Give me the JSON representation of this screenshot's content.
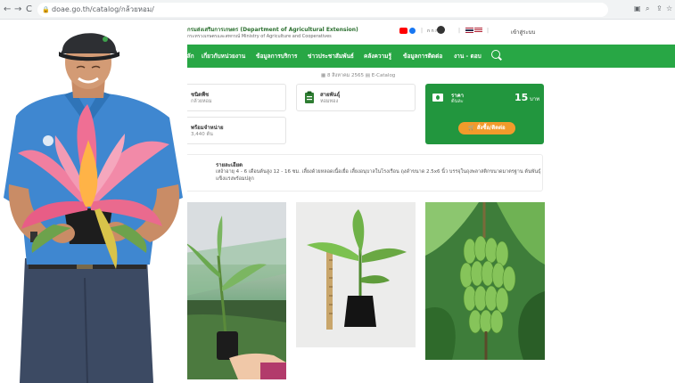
{
  "browser": {
    "url": "doae.go.th/catalog/กล้วยหอม/",
    "back": "←",
    "forward": "→",
    "reload": "C"
  },
  "header": {
    "org_th": "กรมส่งเสริมการเกษตร (Department of Agricultural Extension)",
    "org_en": "กระทรวงเกษตรและสหกรณ์ Ministry of Agriculture and Cooperatives",
    "font_size_label": "ก ก ก",
    "login": "เข้าสู่ระบบ"
  },
  "nav": {
    "items": [
      "หน้าหลัก",
      "เกี่ยวกับหน่วยงาน",
      "ข้อมูลการบริการ",
      "ข่าวประชาสัมพันธ์",
      "คลังความรู้",
      "ข้อมูลการติดต่อ",
      "งาน - ตอบ"
    ]
  },
  "meta": {
    "date": "8 สิงหาคม 2565",
    "tag": "E-Catalog"
  },
  "cards": {
    "variety": {
      "title": "ชนิดพืช",
      "value": "กล้วยหอม"
    },
    "type": {
      "title": "สายพันธุ์",
      "value": "หอมทอง"
    },
    "stock": {
      "title": "พร้อมจำหน่าย",
      "value": "3,440 ต้น"
    }
  },
  "price": {
    "label": "ราคา",
    "sub": "ต้นละ",
    "value": "15",
    "unit": "บาท",
    "button": "สั่งซื้อ/ติดต่อ"
  },
  "description": {
    "title": "รายละเอียด",
    "text": "เหง้าอายุ 4 - 6 เดือนต้นสูง 12 - 16 ซม. เลี้ยงด้วยหลอดเนื้อเยื่อ เลี้ยงอนุบาลในโรงเรือน ถุงดำขนาด 2.5x6 นิ้ว บรรจุในถุงพลาสติกขนาดมาตรฐาน ต้นพันธุ์แข็งแรงพร้อมปลูก"
  },
  "colors": {
    "nav_green": "#28a745",
    "price_green": "#22963e",
    "buy_orange": "#f29b2b"
  }
}
